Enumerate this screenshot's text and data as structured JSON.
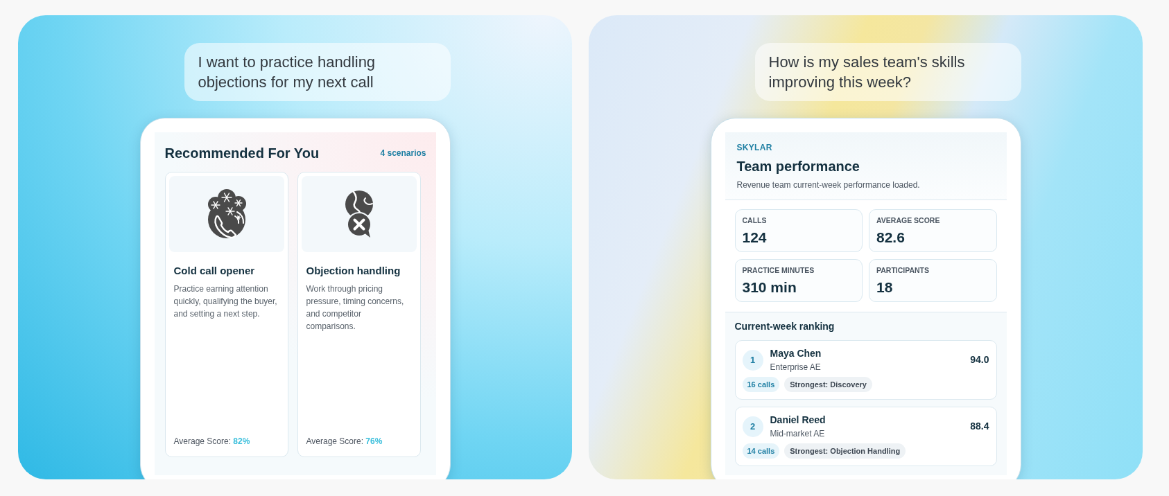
{
  "recommendation_panel": {
    "prompt": "I want to practice handling objections for my next call",
    "screen": {
      "title": "Recommended For You",
      "count": "4 scenarios",
      "scenarios": [
        {
          "title": "Cold call opener",
          "description": "Practice earning attention quickly, qualifying the buyer, and setting a next step.",
          "score_label": "Average Score:",
          "score": "82%"
        },
        {
          "title": "Objection handling",
          "description": "Work through pricing pressure, timing concerns, and competitor comparisons.",
          "score_label": "Average Score:",
          "score": "76%"
        }
      ]
    }
  },
  "team_panel": {
    "prompt": "How is my sales team's skills improving this week?",
    "screen": {
      "brand": "SKYLAR",
      "title": "Team performance",
      "subtitle": "Revenue team current-week performance loaded.",
      "stats": [
        {
          "label": "CALLS",
          "value": "124"
        },
        {
          "label": "AVERAGE SCORE",
          "value": "82.6"
        },
        {
          "label": "PRACTICE MINUTES",
          "value": "310 min"
        },
        {
          "label": "PARTICIPANTS",
          "value": "18"
        }
      ],
      "ranking_title": "Current-week ranking",
      "ranking": [
        {
          "rank": "1",
          "name": "Maya Chen",
          "role": "Enterprise AE",
          "score": "94.0",
          "calls": "16 calls",
          "strongest": "Strongest: Discovery"
        },
        {
          "rank": "2",
          "name": "Daniel Reed",
          "role": "Mid-market AE",
          "score": "88.4",
          "calls": "14 calls",
          "strongest": "Strongest: Objection Handling"
        }
      ]
    }
  }
}
